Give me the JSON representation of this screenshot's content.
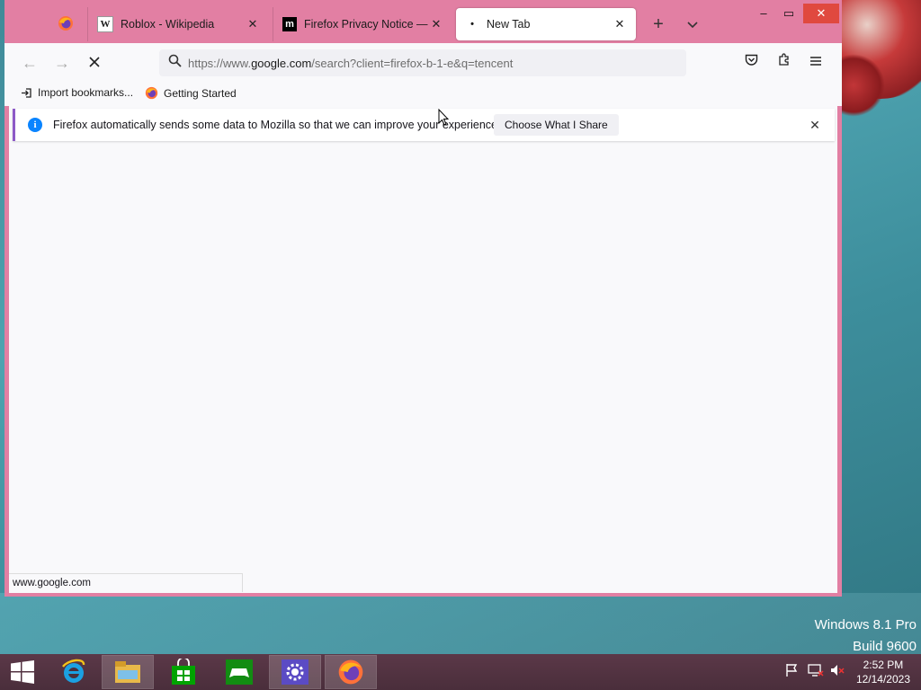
{
  "desktop": {
    "watermark_line1": "Windows 8.1 Pro",
    "watermark_line2": "Build 9600"
  },
  "browser": {
    "tabs": [
      {
        "label": "",
        "icon": "firefox-icon"
      },
      {
        "label": "Roblox - Wikipedia",
        "icon": "wikipedia-icon",
        "icon_text": "W"
      },
      {
        "label": "Firefox Privacy Notice — Mozilla",
        "icon": "mozilla-icon",
        "icon_text": "m"
      },
      {
        "label": "New Tab",
        "icon": "loading-dot-icon",
        "active": true
      }
    ],
    "new_tab_symbol": "+",
    "url": {
      "prefix": "https://www.",
      "host": "google.com",
      "path": "/search?client=firefox-b-1-e&q=tencent"
    },
    "bookmarks": [
      {
        "label": "Import bookmarks...",
        "icon": "import-icon"
      },
      {
        "label": "Getting Started",
        "icon": "firefox-icon"
      }
    ],
    "notification": {
      "text": "Firefox automatically sends some data to Mozilla so that we can improve your experience.",
      "button": "Choose What I Share",
      "info_symbol": "i"
    },
    "status_url": "www.google.com",
    "accent_color": "#e27fa3"
  },
  "taskbar": {
    "apps": [
      "start-icon",
      "internet-explorer-icon",
      "file-explorer-icon",
      "store-icon",
      "games-icon",
      "settings-icon",
      "firefox-icon"
    ],
    "time": "2:52 PM",
    "date": "12/14/2023"
  }
}
